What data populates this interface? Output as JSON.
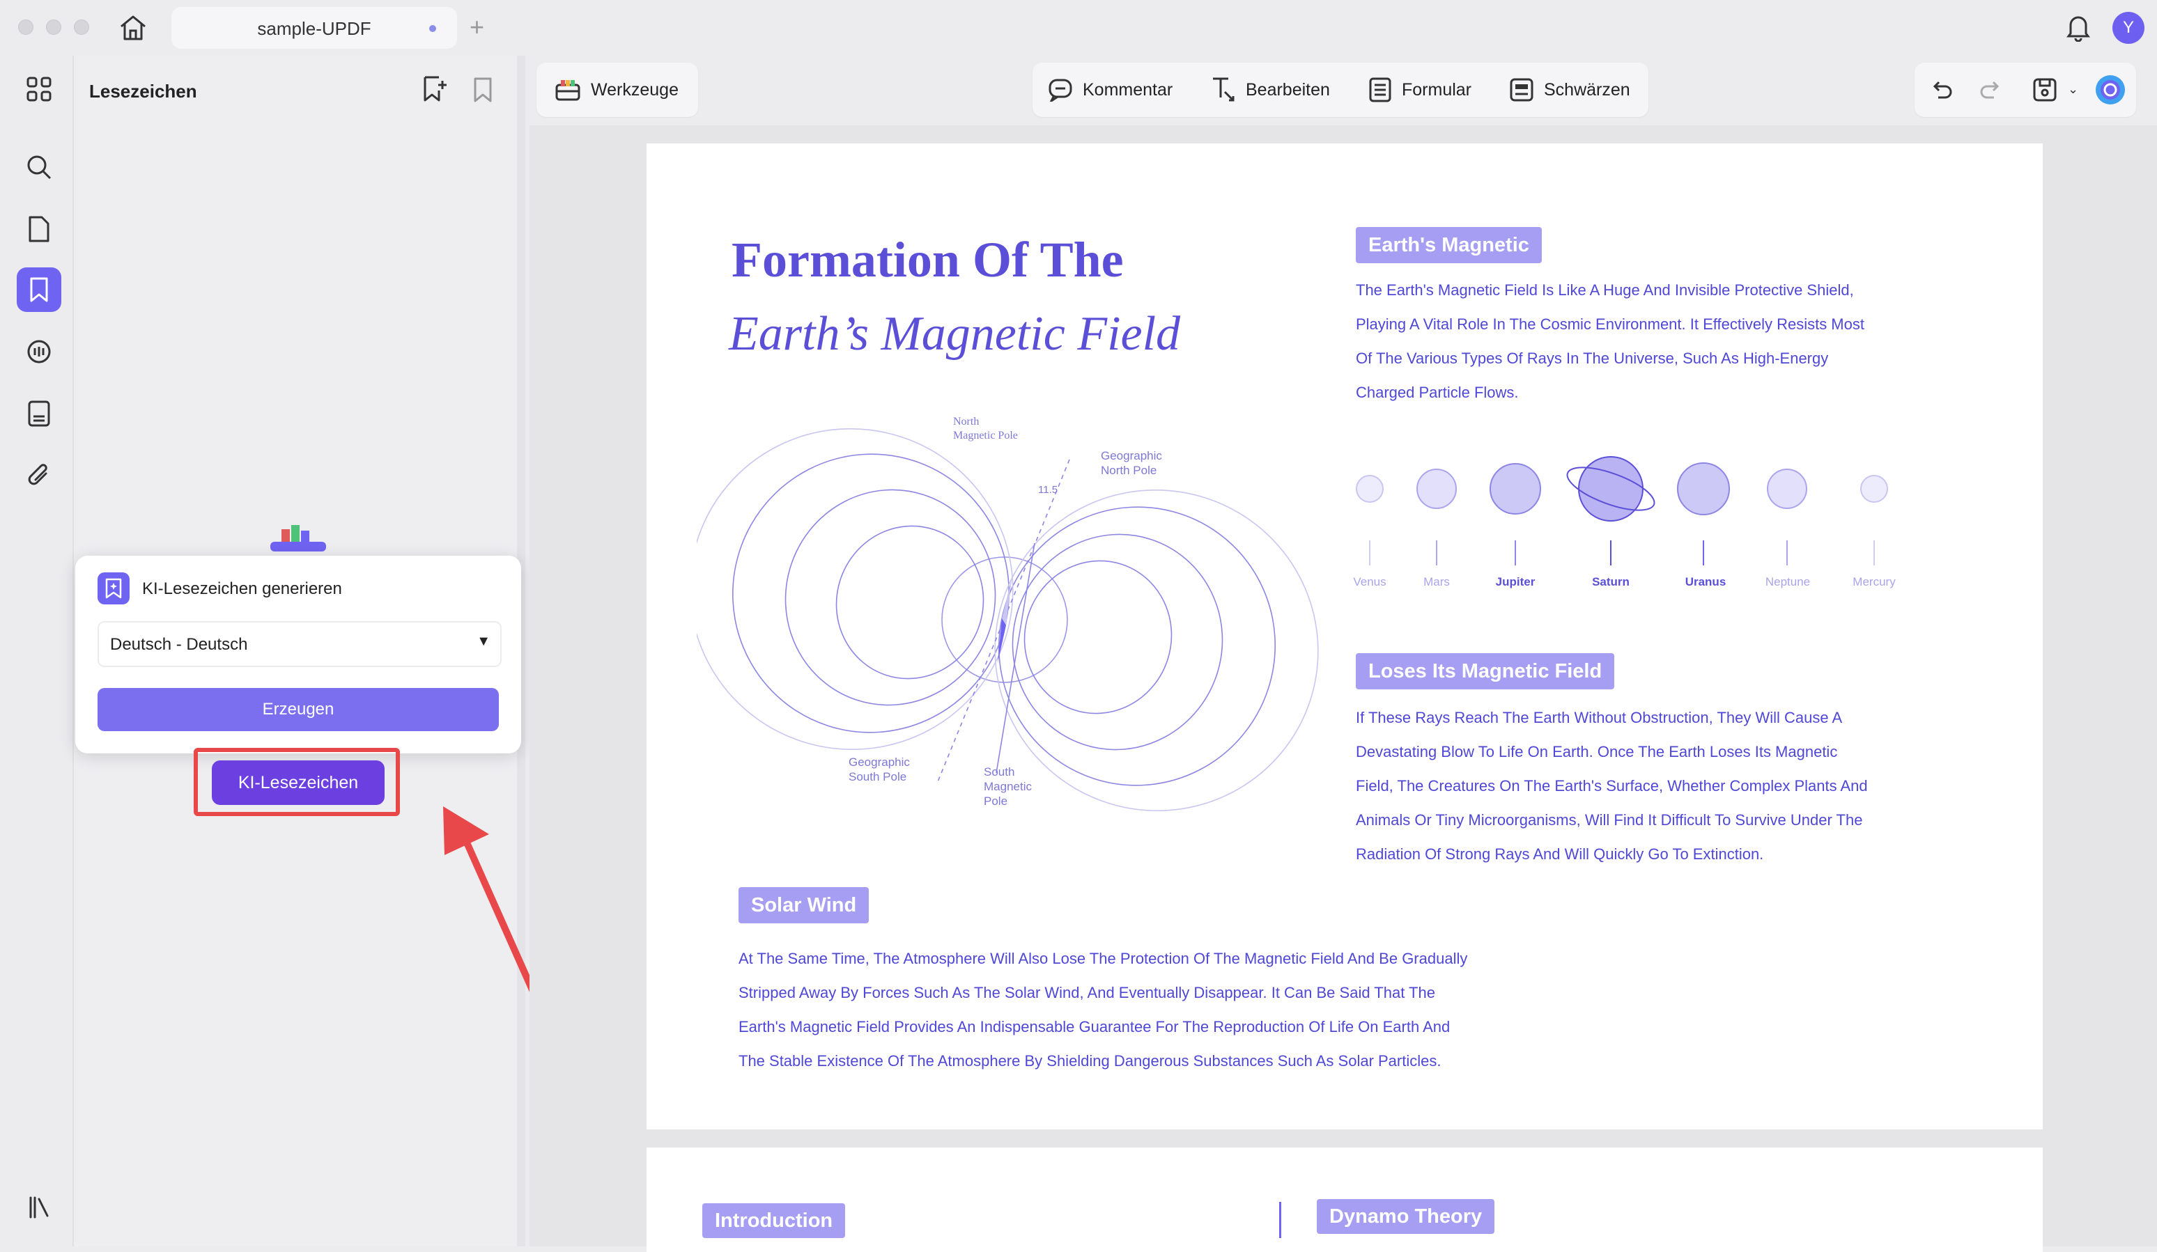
{
  "window": {
    "tab_title": "sample-UPDF",
    "avatar_initial": "Y"
  },
  "panel": {
    "title": "Lesezeichen"
  },
  "popup": {
    "title": "KI-Lesezeichen generieren",
    "language_value": "Deutsch - Deutsch",
    "generate_label": "Erzeugen"
  },
  "ki_button": {
    "label": "KI-Lesezeichen"
  },
  "toolbar": {
    "tools_label": "Werkzeuge",
    "comment_label": "Kommentar",
    "edit_label": "Bearbeiten",
    "form_label": "Formular",
    "redact_label": "Schwärzen"
  },
  "document": {
    "title_line1": "Formation Of The",
    "title_line2": "Earth’s Magnetic Field",
    "diagram_labels": {
      "north_magnetic": "North\nMagnetic Pole",
      "geographic_north": "Geographic\nNorth Pole",
      "geographic_south": "Geographic\nSouth Pole",
      "south_magnetic": "South\nMagnetic\nPole",
      "angle": "11.5"
    },
    "sections": {
      "earths_magnetic": {
        "tag": "Earth's Magnetic",
        "lines": [
          "The Earth's Magnetic Field Is Like A Huge And Invisible Protective Shield,",
          "Playing A Vital Role In The Cosmic Environment. It Effectively Resists Most",
          "Of The Various Types Of Rays In The Universe, Such As High-Energy",
          "Charged Particle Flows."
        ]
      },
      "loses": {
        "tag": "Loses Its Magnetic Field",
        "lines": [
          "If These Rays Reach The Earth Without Obstruction, They Will Cause A",
          "Devastating Blow To Life On Earth. Once The Earth Loses Its Magnetic",
          "Field, The Creatures On The Earth's Surface, Whether Complex Plants And",
          "Animals Or Tiny Microorganisms, Will Find It Difficult To Survive Under The",
          "Radiation Of Strong Rays And Will Quickly Go To Extinction."
        ]
      },
      "solar_wind": {
        "tag": "Solar Wind",
        "lines": [
          "At The Same Time, The Atmosphere Will Also Lose The Protection Of The Magnetic Field And Be Gradually",
          "Stripped Away By Forces Such As The Solar Wind, And Eventually Disappear. It Can Be Said That The",
          "Earth's Magnetic Field Provides An Indispensable Guarantee For The Reproduction Of Life On Earth And",
          "The Stable Existence Of The Atmosphere By Shielding Dangerous Substances Such As Solar Particles."
        ]
      }
    },
    "planets": [
      "Venus",
      "Mars",
      "Jupiter",
      "Saturn",
      "Uranus",
      "Neptune",
      "Mercury"
    ],
    "page2": {
      "intro_tag": "Introduction",
      "dynamo_tag": "Dynamo Theory"
    }
  }
}
